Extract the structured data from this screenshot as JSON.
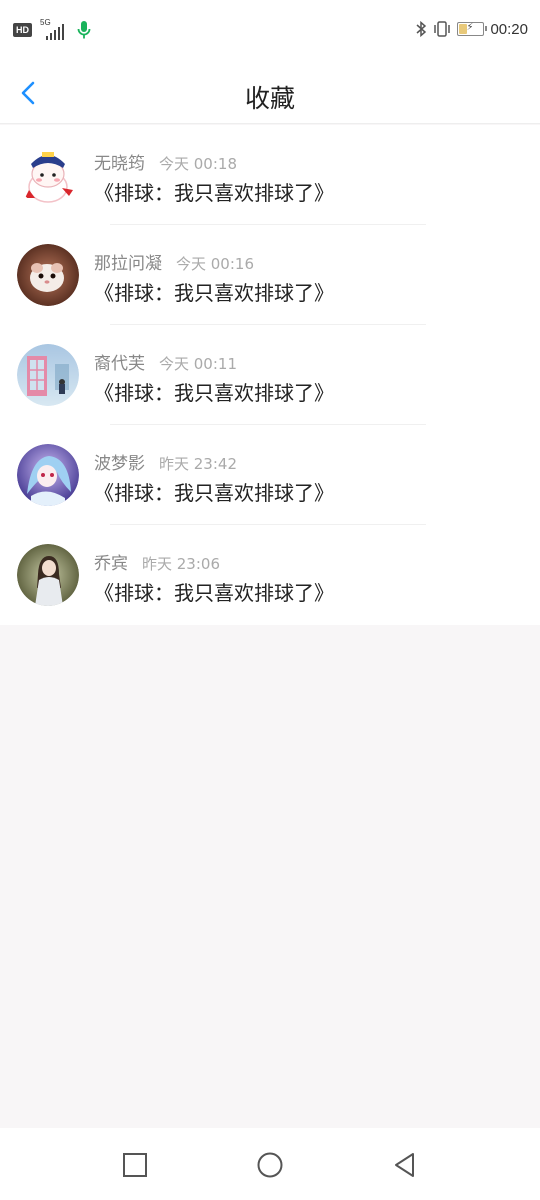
{
  "status_bar": {
    "hd": "HD",
    "network": "5G",
    "time": "00:20",
    "battery_level": 0.35
  },
  "header": {
    "title": "收藏",
    "back_icon": "chevron-left-icon",
    "accent": "#1e90ff"
  },
  "favorites": [
    {
      "user": "无晓筠",
      "time": "今天 00:18",
      "title": "《排球：我只喜欢排球了》",
      "avatar_icon": "cartoon-character-avatar"
    },
    {
      "user": "那拉问凝",
      "time": "今天 00:16",
      "title": "《排球：我只喜欢排球了》",
      "avatar_icon": "hamster-avatar"
    },
    {
      "user": "裔代芙",
      "time": "今天 00:11",
      "title": "《排球：我只喜欢排球了》",
      "avatar_icon": "phone-booth-avatar"
    },
    {
      "user": "波梦影",
      "time": "昨天 23:42",
      "title": "《排球：我只喜欢排球了》",
      "avatar_icon": "anime-girl-avatar"
    },
    {
      "user": "乔宾",
      "time": "昨天 23:06",
      "title": "《排球：我只喜欢排球了》",
      "avatar_icon": "girl-photo-avatar"
    }
  ],
  "system_nav": {
    "recents_icon": "square-icon",
    "home_icon": "circle-icon",
    "back_icon": "triangle-back-icon"
  }
}
